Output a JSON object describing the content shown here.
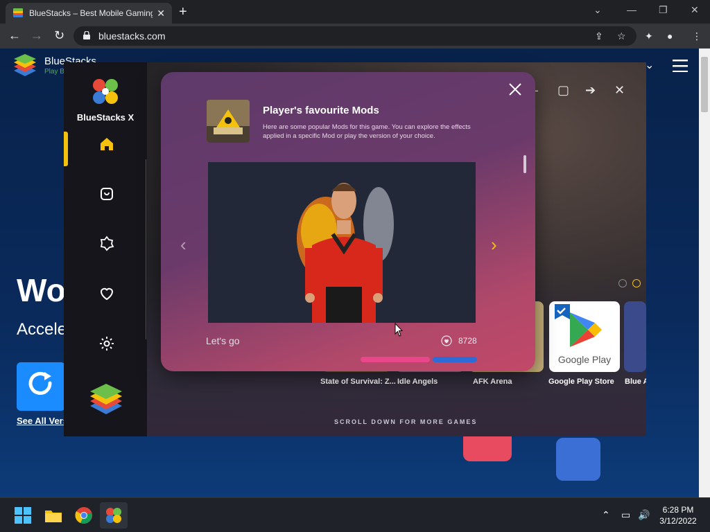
{
  "browser": {
    "tab_title": "BlueStacks – Best Mobile Gaming",
    "tab_close": "✕",
    "new_tab": "+",
    "url": "bluestacks.com"
  },
  "website": {
    "brand": "BlueStacks",
    "brand_sub": "Play Bi",
    "headline": "Wo",
    "subheadline": "Accele",
    "see_all": "See All Vers"
  },
  "bsx": {
    "app_name": "BlueStacks X",
    "games": [
      {
        "label": "State of Survival: Z..."
      },
      {
        "label": "Idle Angels"
      },
      {
        "label": "AFK Arena"
      },
      {
        "label": "Google Play Store"
      },
      {
        "label": "Blue A"
      }
    ],
    "google_play_text": "Google Play",
    "scroll_hint": "SCROLL DOWN FOR MORE GAMES"
  },
  "modal": {
    "title": "Player's favourite Mods",
    "description": "Here are some popular Mods for this game. You can explore the effects applied in a specific Mod or play the version of your choice.",
    "mod_name": "Let's go",
    "likes": "8728",
    "prev_icon": "‹",
    "next_icon": "›"
  },
  "taskbar": {
    "time": "6:28 PM",
    "date": "3/12/2022"
  },
  "colors": {
    "accent": "#f4c20d",
    "modal_start": "#5e3a6a",
    "modal_end": "#c24868",
    "progress_pink": "#e8488a",
    "progress_blue": "#2f6bd6"
  },
  "icons": [
    "bluestacks-favicon",
    "lock-icon",
    "share-icon",
    "star-icon",
    "extensions-icon",
    "profile-icon",
    "menu-dots-icon",
    "home-icon",
    "store-icon",
    "badge-icon",
    "heart-icon",
    "gear-icon",
    "close-icon",
    "heart-like-icon",
    "chevron-left-icon",
    "chevron-right-icon"
  ]
}
